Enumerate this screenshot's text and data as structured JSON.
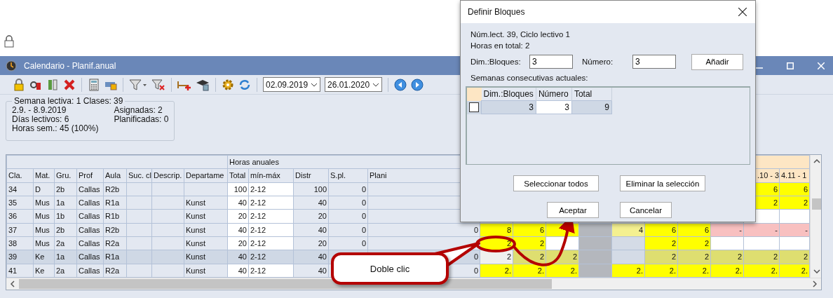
{
  "window": {
    "title": "Calendario - Planif.anual"
  },
  "toolbar": {
    "date_from": "02.09.2019",
    "date_to": "26.01.2020"
  },
  "summary": {
    "legend": "Semana lectiva: 1  Clases: 39",
    "left": [
      "2.9. - 8.9.2019",
      "Días lectivos: 6",
      "Horas sem.: 45 (100%)"
    ],
    "right": [
      "Asignadas: 2",
      "Planificadas: 0"
    ]
  },
  "table": {
    "group_header": "Horas anuales",
    "columns": [
      "Cla.",
      "Mat.",
      "Gru.",
      "Prof",
      "Aula",
      "Suc. cl",
      "Descrip.",
      "Departame",
      "Total",
      "mín-máx",
      "Distr",
      "S.pl.",
      "Plani"
    ],
    "week_headers": [
      ".10 - 3",
      "4.11 - 1"
    ],
    "rows": [
      {
        "cla": "34",
        "mat": "D",
        "gru": "2b",
        "prof": "Callas",
        "aula": "R2b",
        "total": "100",
        "minmax": "2-12",
        "distr": "100",
        "spl": "0",
        "selected": false,
        "weeks": [
          {
            "text": "6",
            "color": "#ffff00"
          },
          {
            "text": "6",
            "color": "#ffff00"
          }
        ]
      },
      {
        "cla": "35",
        "mat": "Mus",
        "gru": "1a",
        "prof": "Callas",
        "aula": "R1a",
        "dept": "Kunst",
        "total": "40",
        "minmax": "2-12",
        "distr": "40",
        "spl": "0",
        "selected": false,
        "weeks": [
          {
            "text": "2",
            "color": "#ffff00"
          },
          {
            "text": "2",
            "color": "#ffff00"
          }
        ]
      },
      {
        "cla": "36",
        "mat": "Mus",
        "gru": "1b",
        "prof": "Callas",
        "aula": "R1b",
        "dept": "Kunst",
        "total": "20",
        "minmax": "2-12",
        "distr": "20",
        "spl": "0",
        "selected": false,
        "weeks": [
          {
            "color": "#ffffff"
          },
          {
            "color": "#ffffff"
          }
        ]
      },
      {
        "cla": "37",
        "mat": "Mus",
        "gru": "2b",
        "prof": "Callas",
        "aula": "R2b",
        "dept": "Kunst",
        "total": "40",
        "minmax": "2-12",
        "distr": "40",
        "spl": "0",
        "plani": "0",
        "selected": false,
        "weeks": [
          {
            "text": "8",
            "color": "#ffff00"
          },
          {
            "text": "6",
            "color": "#ffff00"
          },
          {
            "color": "#ffff00"
          },
          {
            "color": "#b4b7bd"
          },
          {
            "text": "4",
            "color": "#f4f090"
          },
          {
            "text": "6",
            "color": "#ffff00"
          },
          {
            "text": "6",
            "color": "#ffff00"
          },
          {
            "text": "-",
            "color": "#f8c0c0"
          },
          {
            "text": "-",
            "color": "#f8c0c0"
          },
          {
            "text": "-",
            "color": "#f8c0c0"
          }
        ]
      },
      {
        "cla": "38",
        "mat": "Mus",
        "gru": "2a",
        "prof": "Callas",
        "aula": "R2a",
        "dept": "Kunst",
        "total": "20",
        "minmax": "2-12",
        "distr": "20",
        "spl": "0",
        "selected": false,
        "weeks": [
          {
            "text": "2",
            "color": "#ffff00"
          },
          {
            "text": "2",
            "color": "#ffff00"
          },
          {
            "color": "#ffffff"
          },
          {
            "color": "#b4b7bd"
          },
          {
            "color": "#d4dbe6"
          },
          {
            "text": "2",
            "color": "#ffff00"
          },
          {
            "text": "2",
            "color": "#ffff00"
          },
          {
            "color": "#ffffff"
          },
          {
            "color": "#ffffff"
          },
          {
            "color": "#ffffff"
          }
        ]
      },
      {
        "cla": "39",
        "mat": "Ke",
        "gru": "1a",
        "prof": "Callas",
        "aula": "R1a",
        "dept": "Kunst",
        "total": "40",
        "minmax": "2-12",
        "distr": "40",
        "plani": "0",
        "selected": true,
        "weeks": [
          {
            "text": "2",
            "color": "#f0f0ee"
          },
          {
            "text": "2",
            "color": "#dede70"
          },
          {
            "text": "2",
            "color": "#dede70"
          },
          {
            "color": "#b4b7bd"
          },
          {
            "color": "#d4dbe6"
          },
          {
            "text": "2",
            "color": "#dede70"
          },
          {
            "text": "2",
            "color": "#dede70"
          },
          {
            "text": "2",
            "color": "#dede70"
          },
          {
            "text": "2",
            "color": "#dede70"
          },
          {
            "text": "2",
            "color": "#dede70"
          }
        ]
      },
      {
        "cla": "41",
        "mat": "Ke",
        "gru": "2a",
        "prof": "Callas",
        "aula": "R2a",
        "dept": "Kunst",
        "total": "40",
        "minmax": "2-12",
        "distr": "40",
        "plani": "0",
        "selected": false,
        "weeks": [
          {
            "text": "2.",
            "color": "#ffff00"
          },
          {
            "text": "2.",
            "color": "#ffff00"
          },
          {
            "text": "2.",
            "color": "#ffff00"
          },
          {
            "color": "#b4b7bd"
          },
          {
            "text": "2.",
            "color": "#ffff00"
          },
          {
            "text": "2.",
            "color": "#ffff00"
          },
          {
            "text": "2.",
            "color": "#ffff00"
          },
          {
            "text": "2.",
            "color": "#ffff00"
          },
          {
            "text": "2.",
            "color": "#ffff00"
          },
          {
            "text": "2.",
            "color": "#ffff00"
          }
        ]
      }
    ]
  },
  "dialog": {
    "title": "Definir Bloques",
    "lines": [
      "Núm.lect. 39, Ciclo lectivo 1",
      "Horas en total: 2"
    ],
    "size_label": "Dim.:Bloques:",
    "size_value": "3",
    "number_label": "Número:",
    "number_value": "3",
    "add_button": "Añadir",
    "list_label": "Semanas consecutivas actuales:",
    "grid": {
      "columns": [
        "Dim.:Bloques",
        "Número",
        "Total"
      ],
      "rows": [
        {
          "checked": false,
          "cells": [
            "3",
            "3",
            "9"
          ]
        }
      ]
    },
    "buttons": [
      "Seleccionar todos",
      "Eliminar la selección"
    ],
    "footer_buttons": [
      "Aceptar",
      "Cancelar"
    ]
  },
  "callout": {
    "text": "Doble clic"
  }
}
